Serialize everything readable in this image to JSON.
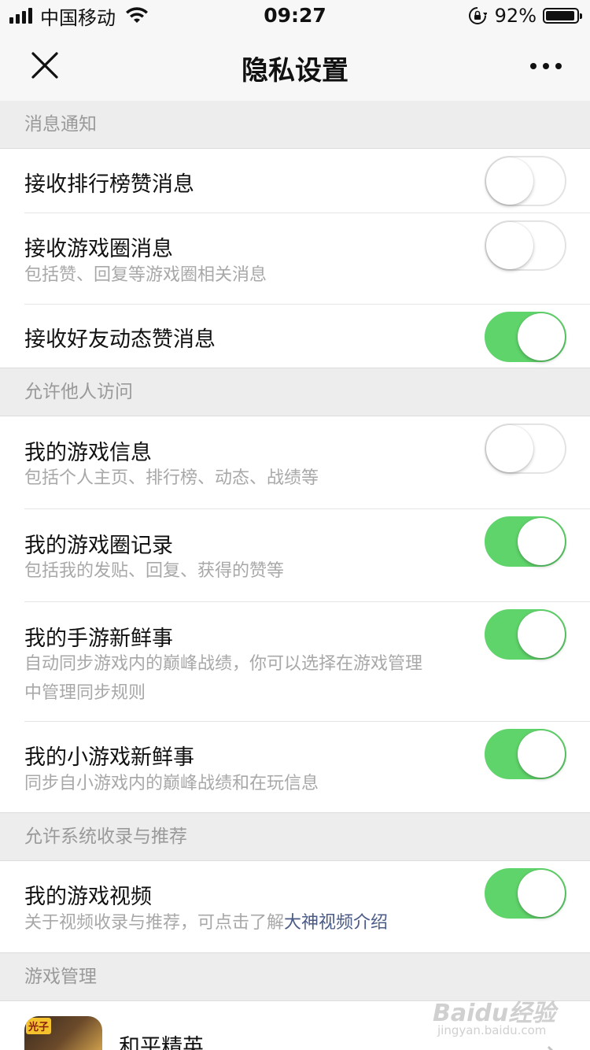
{
  "status_bar": {
    "carrier": "中国移动",
    "time": "09:27",
    "battery_percent": "92%",
    "battery_level": 0.92
  },
  "nav": {
    "title": "隐私设置"
  },
  "sections": [
    {
      "header": "消息通知",
      "items": [
        {
          "title": "接收排行榜赞消息",
          "desc": "",
          "enabled": false
        },
        {
          "title": "接收游戏圈消息",
          "desc": "包括赞、回复等游戏圈相关消息",
          "enabled": false
        },
        {
          "title": "接收好友动态赞消息",
          "desc": "",
          "enabled": true
        }
      ]
    },
    {
      "header": "允许他人访问",
      "items": [
        {
          "title": "我的游戏信息",
          "desc": "包括个人主页、排行榜、动态、战绩等",
          "enabled": false
        },
        {
          "title": "我的游戏圈记录",
          "desc": "包括我的发贴、回复、获得的赞等",
          "enabled": true
        },
        {
          "title": "我的手游新鲜事",
          "desc": "自动同步游戏内的巅峰战绩，你可以选择在游戏管理中管理同步规则",
          "enabled": true
        },
        {
          "title": "我的小游戏新鲜事",
          "desc": "同步自小游戏内的巅峰战绩和在玩信息",
          "enabled": true
        }
      ]
    },
    {
      "header": "允许系统收录与推荐",
      "items": [
        {
          "title": "我的游戏视频",
          "desc": "关于视频收录与推荐，可点击了解",
          "desc_link": "大神视频介绍",
          "enabled": true
        }
      ]
    },
    {
      "header": "游戏管理",
      "games": [
        {
          "name": "和平精英",
          "icon_badge": "光子"
        }
      ]
    }
  ],
  "watermark": {
    "brand": "Baidu经验",
    "site": "jingyan.baidu.com"
  },
  "colors": {
    "toggle_on": "#5fd46a",
    "section_bg": "#ededed",
    "link": "#4a5b86"
  }
}
